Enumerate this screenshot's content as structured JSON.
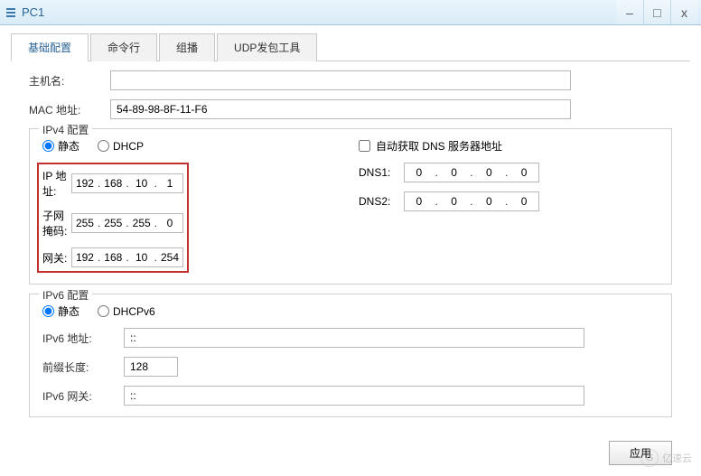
{
  "window": {
    "title": "PC1",
    "minimize": "–",
    "restore": "□",
    "close": "x"
  },
  "tabs": {
    "basic": "基础配置",
    "cmd": "命令行",
    "mcast": "组播",
    "udp": "UDP发包工具"
  },
  "labels": {
    "host": "主机名:",
    "mac": "MAC 地址:",
    "ipv4_legend": "IPv4 配置",
    "static": "静态",
    "dhcp": "DHCP",
    "ip": "IP 地址:",
    "mask": "子网掩码:",
    "gw": "网关:",
    "auto_dns": "自动获取 DNS 服务器地址",
    "dns1": "DNS1:",
    "dns2": "DNS2:",
    "ipv6_legend": "IPv6 配置",
    "dhcpv6": "DHCPv6",
    "ipv6_addr": "IPv6 地址:",
    "prefix": "前缀长度:",
    "ipv6_gw": "IPv6 网关:",
    "apply": "应用"
  },
  "values": {
    "host": "",
    "mac": "54-89-98-8F-11-F6",
    "ip": [
      "192",
      "168",
      "10",
      "1"
    ],
    "mask": [
      "255",
      "255",
      "255",
      "0"
    ],
    "gw": [
      "192",
      "168",
      "10",
      "254"
    ],
    "dns1": [
      "0",
      "0",
      "0",
      "0"
    ],
    "dns2": [
      "0",
      "0",
      "0",
      "0"
    ],
    "ipv6_addr": "::",
    "prefix": "128",
    "ipv6_gw": "::"
  },
  "watermark": "亿速云"
}
